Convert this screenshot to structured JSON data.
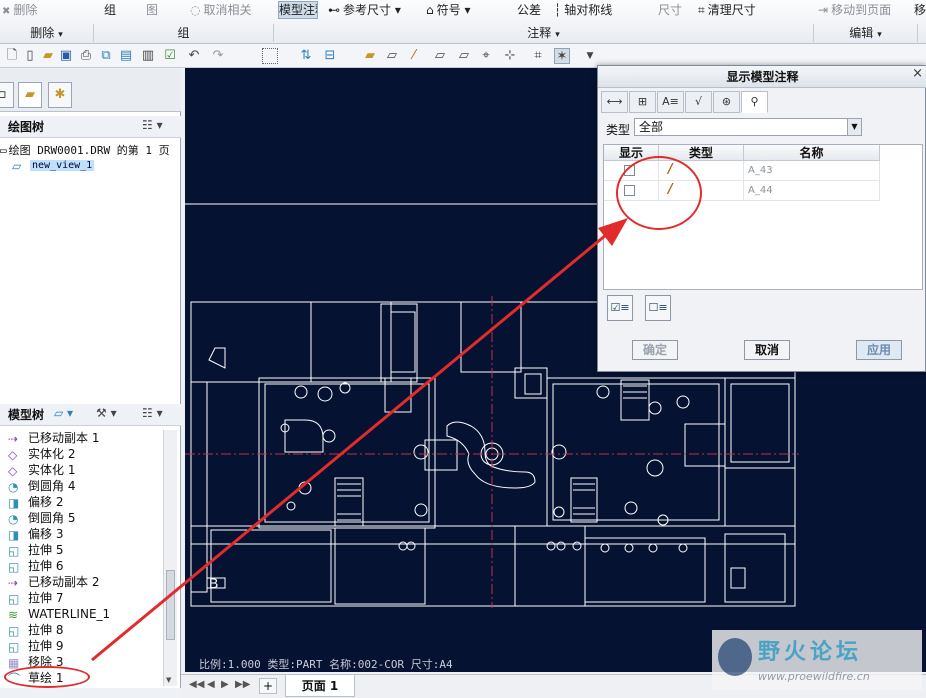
{
  "ribbon": {
    "items": [
      {
        "label": "删除",
        "dim": true
      },
      {
        "label": "组",
        "dim": false
      },
      {
        "label": "图",
        "dim": true
      },
      {
        "label": "取消相关",
        "dim": true
      },
      {
        "label": "显示模型注释",
        "dim": false
      },
      {
        "label": "参考尺寸",
        "dim": false
      },
      {
        "label": "符号",
        "dim": false
      },
      {
        "label": "公差",
        "dim": false
      },
      {
        "label": "轴对称线",
        "dim": false
      },
      {
        "label": "尺寸",
        "dim": true
      },
      {
        "label": "清理尺寸",
        "dim": false
      },
      {
        "label": "移动到页面",
        "dim": true
      },
      {
        "label": "移",
        "dim": false
      }
    ],
    "groups": [
      {
        "label": "删除"
      },
      {
        "label": "组"
      },
      {
        "label": "注释"
      },
      {
        "label": "编辑"
      }
    ]
  },
  "left": {
    "drawing_tree_title": "绘图树",
    "drawing_root": "绘图 DRW0001.DRW 的第 1 页",
    "drawing_view": "new_view_1",
    "model_tree_title": "模型树",
    "model_items": [
      {
        "label": "已移动副本 1",
        "icon": "copy-icon",
        "color": "#7a3fbf"
      },
      {
        "label": "实体化 2",
        "icon": "solidify-icon",
        "color": "#7a3fbf"
      },
      {
        "label": "实体化 1",
        "icon": "solidify-icon",
        "color": "#7a3fbf"
      },
      {
        "label": "倒圆角 4",
        "icon": "round-icon",
        "color": "#2f8fb5"
      },
      {
        "label": "偏移 2",
        "icon": "offset-icon",
        "color": "#2f8fb5"
      },
      {
        "label": "倒圆角 5",
        "icon": "round-icon",
        "color": "#2f8fb5"
      },
      {
        "label": "偏移 3",
        "icon": "offset-icon",
        "color": "#2f8fb5"
      },
      {
        "label": "拉伸 5",
        "icon": "extrude-icon",
        "color": "#2f8fb5"
      },
      {
        "label": "拉伸 6",
        "icon": "extrude-icon",
        "color": "#2f8fb5"
      },
      {
        "label": "已移动副本 2",
        "icon": "copy-icon",
        "color": "#7a3fbf"
      },
      {
        "label": "拉伸 7",
        "icon": "extrude-icon",
        "color": "#2f8fb5"
      },
      {
        "label": "WATERLINE_1",
        "icon": "waterline-icon",
        "color": "#3d9a3d"
      },
      {
        "label": "拉伸 8",
        "icon": "extrude-icon",
        "color": "#2f8fb5"
      },
      {
        "label": "拉伸 9",
        "icon": "extrude-icon",
        "color": "#2f8fb5"
      },
      {
        "label": "移除 3",
        "icon": "remove-icon",
        "color": "#9b8fd0"
      },
      {
        "label": "草绘 1",
        "icon": "sketch-icon",
        "color": "#2f8fb5"
      }
    ]
  },
  "canvas": {
    "status": "比例:1.000  类型:PART  名称:002-COR  尺寸:A4"
  },
  "bottom": {
    "page_tab": "页面 1",
    "add": "+"
  },
  "dialog": {
    "title": "显示模型注释",
    "close": "×",
    "type_label": "类型",
    "type_value": "全部",
    "columns": [
      "显示",
      "类型",
      "名称"
    ],
    "rows": [
      {
        "name": "A_43",
        "checked": false
      },
      {
        "name": "A_44",
        "checked": false
      }
    ],
    "ok": "确定",
    "cancel": "取消",
    "apply": "应用"
  },
  "watermark": {
    "text": "野火论坛",
    "url": "www.proewildfire.cn"
  },
  "colors": {
    "canvas_bg": "#061231",
    "drawing_line": "#ffffff",
    "center_line": "#c0304a",
    "annotation": "#e22b2b"
  }
}
